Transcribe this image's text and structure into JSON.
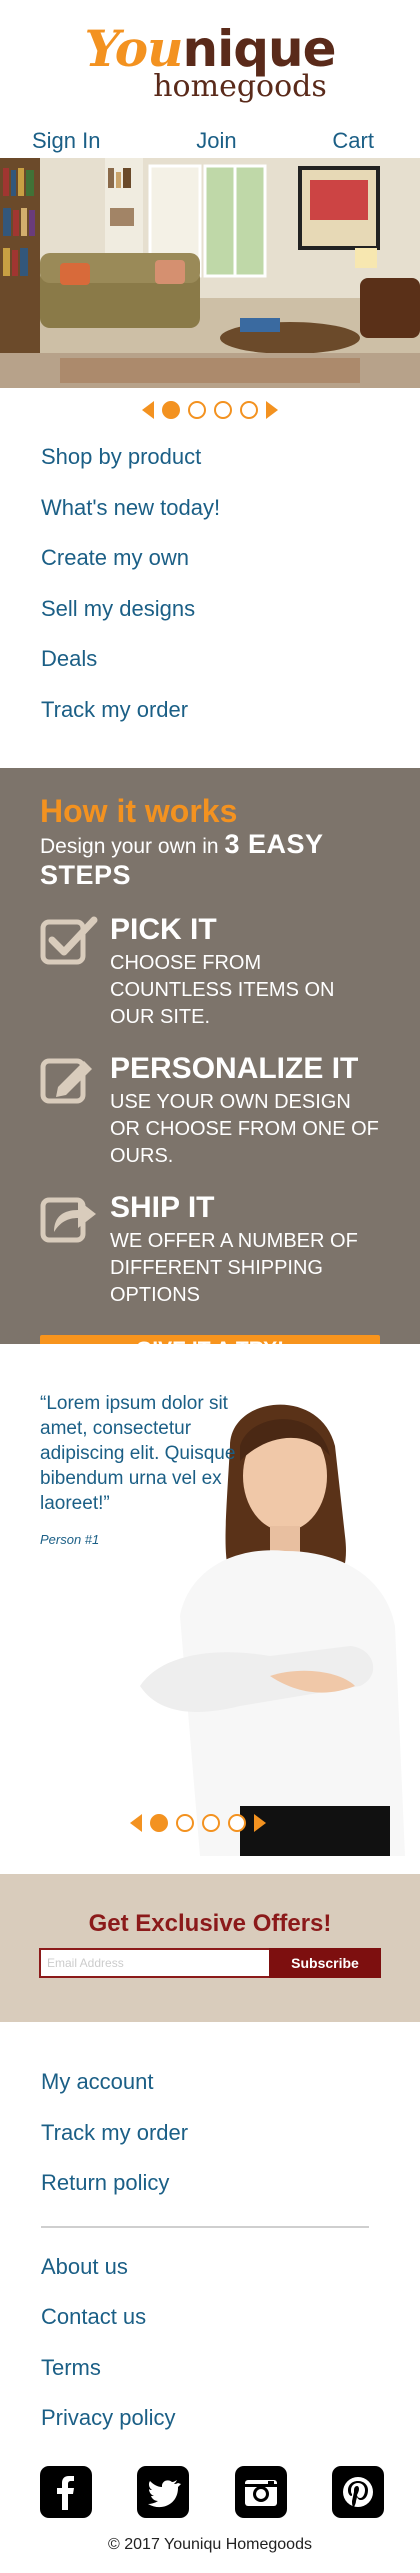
{
  "brand": {
    "logo_you": "You",
    "logo_nique": "nique",
    "logo_sub": "homegoods"
  },
  "topnav": {
    "sign_in": "Sign In",
    "join": "Join",
    "cart": "Cart"
  },
  "menu": {
    "items": [
      "Shop by product",
      "What's new today!",
      "Create my own",
      "Sell my designs",
      "Deals",
      "Track my order"
    ]
  },
  "how": {
    "title": "How it works",
    "sub_prefix": "Design your own in",
    "sub_bold": "3 EASY STEPS",
    "steps": [
      {
        "icon": "checkbox-icon",
        "title": "PICK IT",
        "desc": "Choose from countless items on our site."
      },
      {
        "icon": "edit-pencil-icon",
        "title": "PERSONALIZE IT",
        "desc": "Use your own design or choose from one of ours."
      },
      {
        "icon": "share-arrow-icon",
        "title": "SHIP IT",
        "desc": "We offer a number of different shipping options"
      }
    ],
    "cta": "GIVE IT A TRY!"
  },
  "testimonial": {
    "quote": "“Lorem ipsum dolor sit amet, consectetur adipiscing elit. Quisque bibendum urna vel ex laoreet!”",
    "author": "Person #1"
  },
  "offers": {
    "title": "Get Exclusive Offers!",
    "placeholder": "Email Address",
    "button": "Subscribe"
  },
  "footer": {
    "group1": [
      "My account",
      "Track my order",
      "Return policy"
    ],
    "group2": [
      "About us",
      "Contact us",
      "Terms",
      "Privacy policy"
    ],
    "social": [
      "facebook-icon",
      "twitter-icon",
      "instagram-icon",
      "pinterest-icon"
    ],
    "copyright": "© 2017 Youniqu Homegoods"
  },
  "carousel": {
    "slide_count": 4,
    "active_index": 0
  },
  "colors": {
    "accent": "#f39220",
    "link": "#1b5f86",
    "how_bg": "#7d746b",
    "offers_bg": "#d9ccbc",
    "brand_dark": "#7d0f0f"
  }
}
